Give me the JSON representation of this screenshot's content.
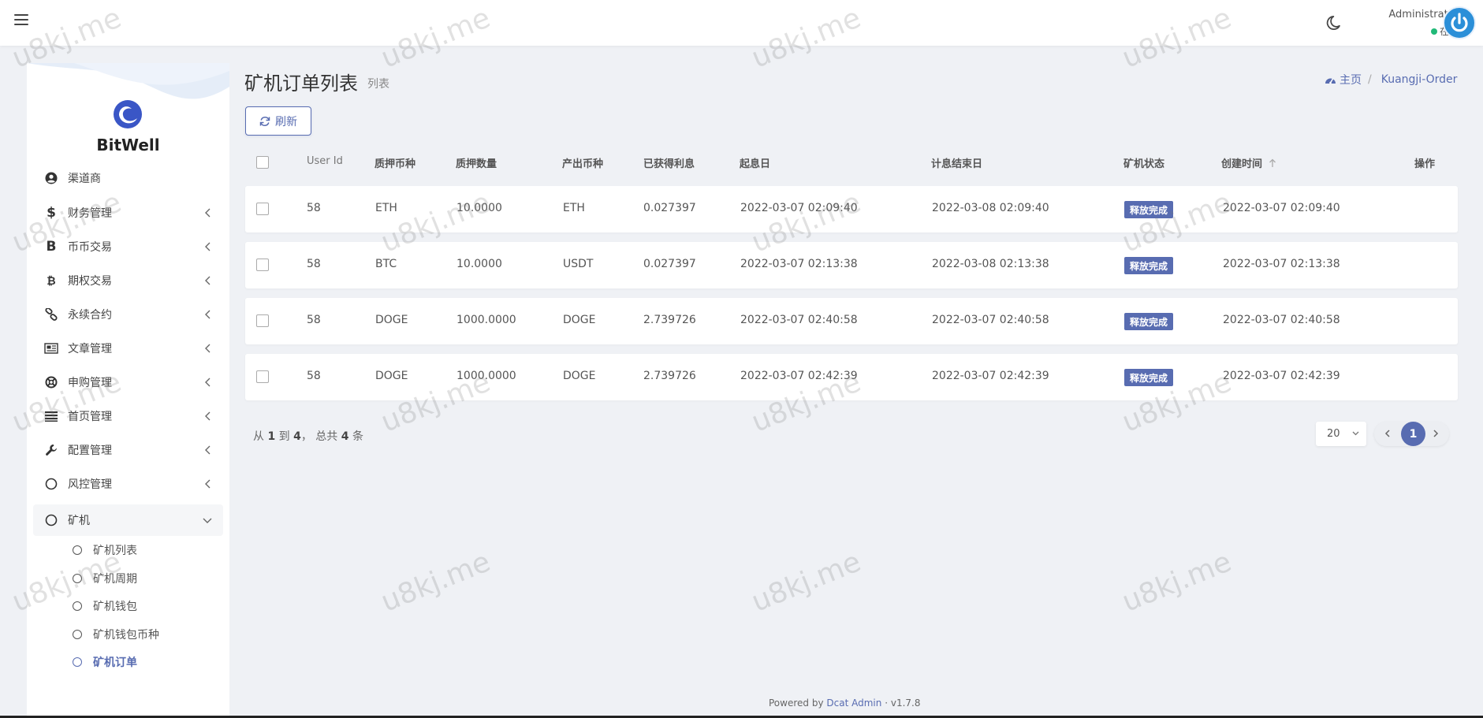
{
  "header": {
    "user_name": "Administrator",
    "user_status": "在线"
  },
  "sidebar": {
    "brand": "BitWell",
    "items": [
      {
        "label": "渠道商",
        "icon": "user-circle-icon"
      },
      {
        "label": "财务管理",
        "icon": "dollar-icon"
      },
      {
        "label": "币币交易",
        "icon": "bold-b-icon"
      },
      {
        "label": "期权交易",
        "icon": "bitcoin-icon"
      },
      {
        "label": "永续合约",
        "icon": "link-icon"
      },
      {
        "label": "文章管理",
        "icon": "newspaper-icon"
      },
      {
        "label": "申购管理",
        "icon": "lifebuoy-icon"
      },
      {
        "label": "首页管理",
        "icon": "list-icon"
      },
      {
        "label": "配置管理",
        "icon": "wrench-icon"
      },
      {
        "label": "风控管理",
        "icon": "circle-icon"
      },
      {
        "label": "矿机",
        "icon": "circle-icon"
      }
    ],
    "sub_items": [
      {
        "label": "矿机列表"
      },
      {
        "label": "矿机周期"
      },
      {
        "label": "矿机钱包"
      },
      {
        "label": "矿机钱包币种"
      },
      {
        "label": "矿机订单"
      }
    ]
  },
  "page": {
    "title": "矿机订单列表",
    "subtitle": "列表",
    "breadcrumb": {
      "home": "主页",
      "current": "Kuangji-Order"
    },
    "refresh_label": "刷新"
  },
  "table": {
    "columns": [
      "User Id",
      "质押币种",
      "质押数量",
      "产出币种",
      "已获得利息",
      "起息日",
      "计息结束日",
      "矿机状态",
      "创建时间",
      "操作"
    ],
    "rows": [
      {
        "user_id": "58",
        "pledge_coin": "ETH",
        "pledge_amount": "10.0000",
        "output_coin": "ETH",
        "interest": "0.027397",
        "start_date": "2022-03-07 02:09:40",
        "end_date": "2022-03-08 02:09:40",
        "status": "释放完成",
        "created": "2022-03-07 02:09:40"
      },
      {
        "user_id": "58",
        "pledge_coin": "BTC",
        "pledge_amount": "10.0000",
        "output_coin": "USDT",
        "interest": "0.027397",
        "start_date": "2022-03-07 02:13:38",
        "end_date": "2022-03-08 02:13:38",
        "status": "释放完成",
        "created": "2022-03-07 02:13:38"
      },
      {
        "user_id": "58",
        "pledge_coin": "DOGE",
        "pledge_amount": "1000.0000",
        "output_coin": "DOGE",
        "interest": "2.739726",
        "start_date": "2022-03-07 02:40:58",
        "end_date": "2022-03-07 02:40:58",
        "status": "释放完成",
        "created": "2022-03-07 02:40:58"
      },
      {
        "user_id": "58",
        "pledge_coin": "DOGE",
        "pledge_amount": "1000.0000",
        "output_coin": "DOGE",
        "interest": "2.739726",
        "start_date": "2022-03-07 02:42:39",
        "end_date": "2022-03-07 02:42:39",
        "status": "释放完成",
        "created": "2022-03-07 02:42:39"
      }
    ]
  },
  "pagination": {
    "summary_prefix": "从",
    "from": "1",
    "to_word": "到",
    "to": "4",
    "total_word": "， 总共",
    "total": "4",
    "suffix": "条",
    "per_page": "20",
    "current_page": "1"
  },
  "footer": {
    "powered_by": "Powered by",
    "brand": "Dcat Admin",
    "sep": "·",
    "version": "v1.7.8"
  },
  "watermark": "u8kj.me",
  "colors": {
    "accent": "#586cb1",
    "online": "#21b978",
    "avatar": "#2b8fd8"
  }
}
